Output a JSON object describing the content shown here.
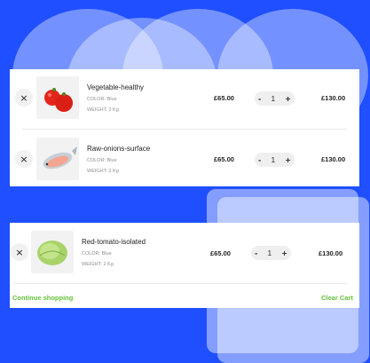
{
  "cart_top": {
    "items": [
      {
        "name": "Vegetable-healthy",
        "color_label": "COLOR: Blue",
        "weight_label": "WEIGHT: 2 Kg",
        "price": "£65.00",
        "quantity": "1",
        "total": "£130.00",
        "image": "tomatoes"
      },
      {
        "name": "Raw-onions-surface",
        "color_label": "COLOR: Blue",
        "weight_label": "WEIGHT: 2 Kg",
        "price": "£65.00",
        "quantity": "1",
        "total": "£130.00",
        "image": "fish"
      }
    ]
  },
  "cart_bottom": {
    "items": [
      {
        "name": "Red-tomato-isolated",
        "color_label": "COLOR: Blue",
        "weight_label": "WEIGHT: 2 Kg",
        "price": "£65.00",
        "quantity": "1",
        "total": "£130.00",
        "image": "lettuce"
      }
    ],
    "continue_label": "Continue shopping",
    "clear_label": "Clear Cart"
  },
  "controls": {
    "remove_glyph": "×",
    "minus_glyph": "-",
    "plus_glyph": "+"
  },
  "colors": {
    "background": "#1f4fff",
    "accent": "#64c23a"
  }
}
